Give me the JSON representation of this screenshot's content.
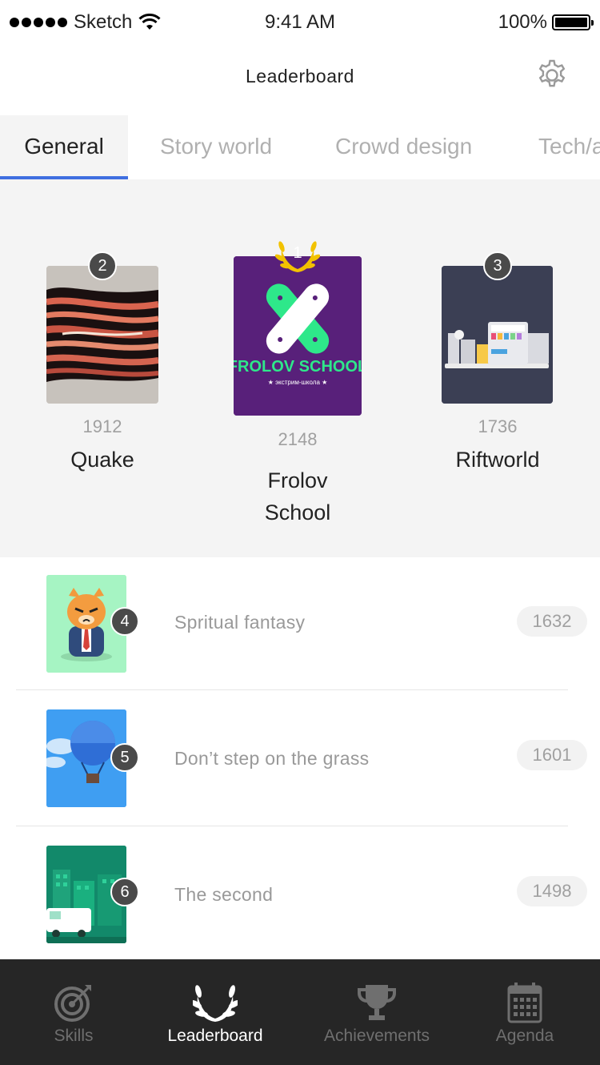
{
  "status_bar": {
    "carrier": "Sketch",
    "time": "9:41 AM",
    "battery": "100%"
  },
  "header": {
    "title": "Leaderboard",
    "settings_icon": "gear-icon"
  },
  "tabs": [
    {
      "label": "General",
      "active": true
    },
    {
      "label": "Story world",
      "active": false
    },
    {
      "label": "Crowd design",
      "active": false
    },
    {
      "label": "Tech/a",
      "active": false
    }
  ],
  "podium": {
    "first": {
      "rank": "1",
      "score": "2148",
      "name_line1": "Frolov",
      "name_line2": "School",
      "image": "frolov-school-logo",
      "logo_title": "FROLOV SCHOOL",
      "logo_sub": "★ экстрим-школа ★"
    },
    "second": {
      "rank": "2",
      "score": "1912",
      "name": "Quake",
      "image": "distorted-face-art"
    },
    "third": {
      "rank": "3",
      "score": "1736",
      "name": "Riftworld",
      "image": "lab-machine-illustration"
    }
  },
  "list": [
    {
      "rank": "4",
      "name": "Spritual fantasy",
      "score": "1632",
      "image": "grumpy-cat-illustration"
    },
    {
      "rank": "5",
      "name": "Don’t step on the grass",
      "score": "1601",
      "image": "hot-air-balloon-illustration"
    },
    {
      "rank": "6",
      "name": "The second",
      "score": "1498",
      "image": "city-van-illustration"
    }
  ],
  "tabbar": [
    {
      "label": "Skills",
      "icon": "target-icon",
      "active": false
    },
    {
      "label": "Leaderboard",
      "icon": "laurel-wreath-icon",
      "active": true
    },
    {
      "label": "Achievements",
      "icon": "trophy-icon",
      "active": false
    },
    {
      "label": "Agenda",
      "icon": "calendar-icon",
      "active": false
    }
  ],
  "colors": {
    "accent": "#3f6fe0",
    "podium_bg": "#f4f4f4",
    "tabbar_bg": "#262626",
    "badge": "#4a4a4a",
    "laurel_gold": "#f2c200"
  }
}
